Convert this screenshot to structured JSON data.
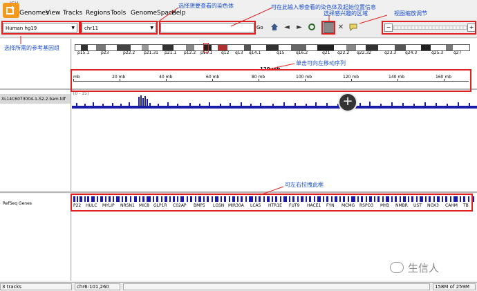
{
  "window": {
    "title": "IGV"
  },
  "menu": [
    "Genomes",
    "View",
    "Tracks",
    "Regions",
    "Tools",
    "GenomeSpace",
    "Help"
  ],
  "toolbar": {
    "genome": "Human hg19",
    "chromosome": "chr11",
    "go_label": "Go",
    "icons": [
      "home-icon",
      "back-icon",
      "forward-icon",
      "refresh-icon",
      "region-of-interest-icon",
      "resize-icon",
      "popup-text-icon",
      "zoom-out-icon",
      "zoom-in-icon"
    ]
  },
  "ideogram": {
    "bands": [
      "p15.1",
      "p23",
      "p22.2",
      "p21.31",
      "p21.1",
      "p12.2",
      "p11.1",
      "q12",
      "q13",
      "q14.1",
      "q15",
      "q16.2",
      "q21",
      "q22.2",
      "q22.32",
      "q23.3",
      "q24.3",
      "q25.3",
      "q27"
    ]
  },
  "ruler": {
    "span": "120 mb",
    "ticks": [
      "mb",
      "20 mb",
      "40 mb",
      "60 mb",
      "80 mb",
      "100 mb",
      "120 mb",
      "140 mb",
      "160 mb"
    ]
  },
  "tracks": {
    "bam_name": "XL14C6073004-1-S2.2.bam.tdf",
    "bam_scale": "[0 - 15]",
    "gene_track_name": "RefSeq Genes",
    "genes": [
      "P22",
      "HULC",
      "MYLIP",
      "NRSN1",
      "MIC8",
      "GLP1R",
      "C02AP",
      "BMP5",
      "LGSN",
      "MIR30A",
      "LCA5",
      "HTR1E",
      "FUT9",
      "HACE1",
      "FYN",
      "MCMG",
      "RSPO3",
      "MYB",
      "NMBR",
      "UST",
      "NOX3",
      "CAHM",
      "TB"
    ]
  },
  "annotations": {
    "select_chromosome": "选择想要查看的染色体",
    "input_position": "可在此输入想查看的染色体及起始位置信息",
    "select_region": "选择感兴趣的区域",
    "zoom_adjust": "视图缩放调节",
    "select_genome": "选择所需的参考基因组",
    "click_move": "单击可向左移动序列",
    "drag_frame": "可左右拉拽此框"
  },
  "status": {
    "tracks": "3 tracks",
    "position": "chr6:101,260",
    "memory": "158M of 259M"
  },
  "watermark": "生信人",
  "colors": {
    "accent": "#e02020",
    "annotation": "#1a4fd0",
    "coverage": "#1a1aa8",
    "genes": "#1a1aa8"
  }
}
